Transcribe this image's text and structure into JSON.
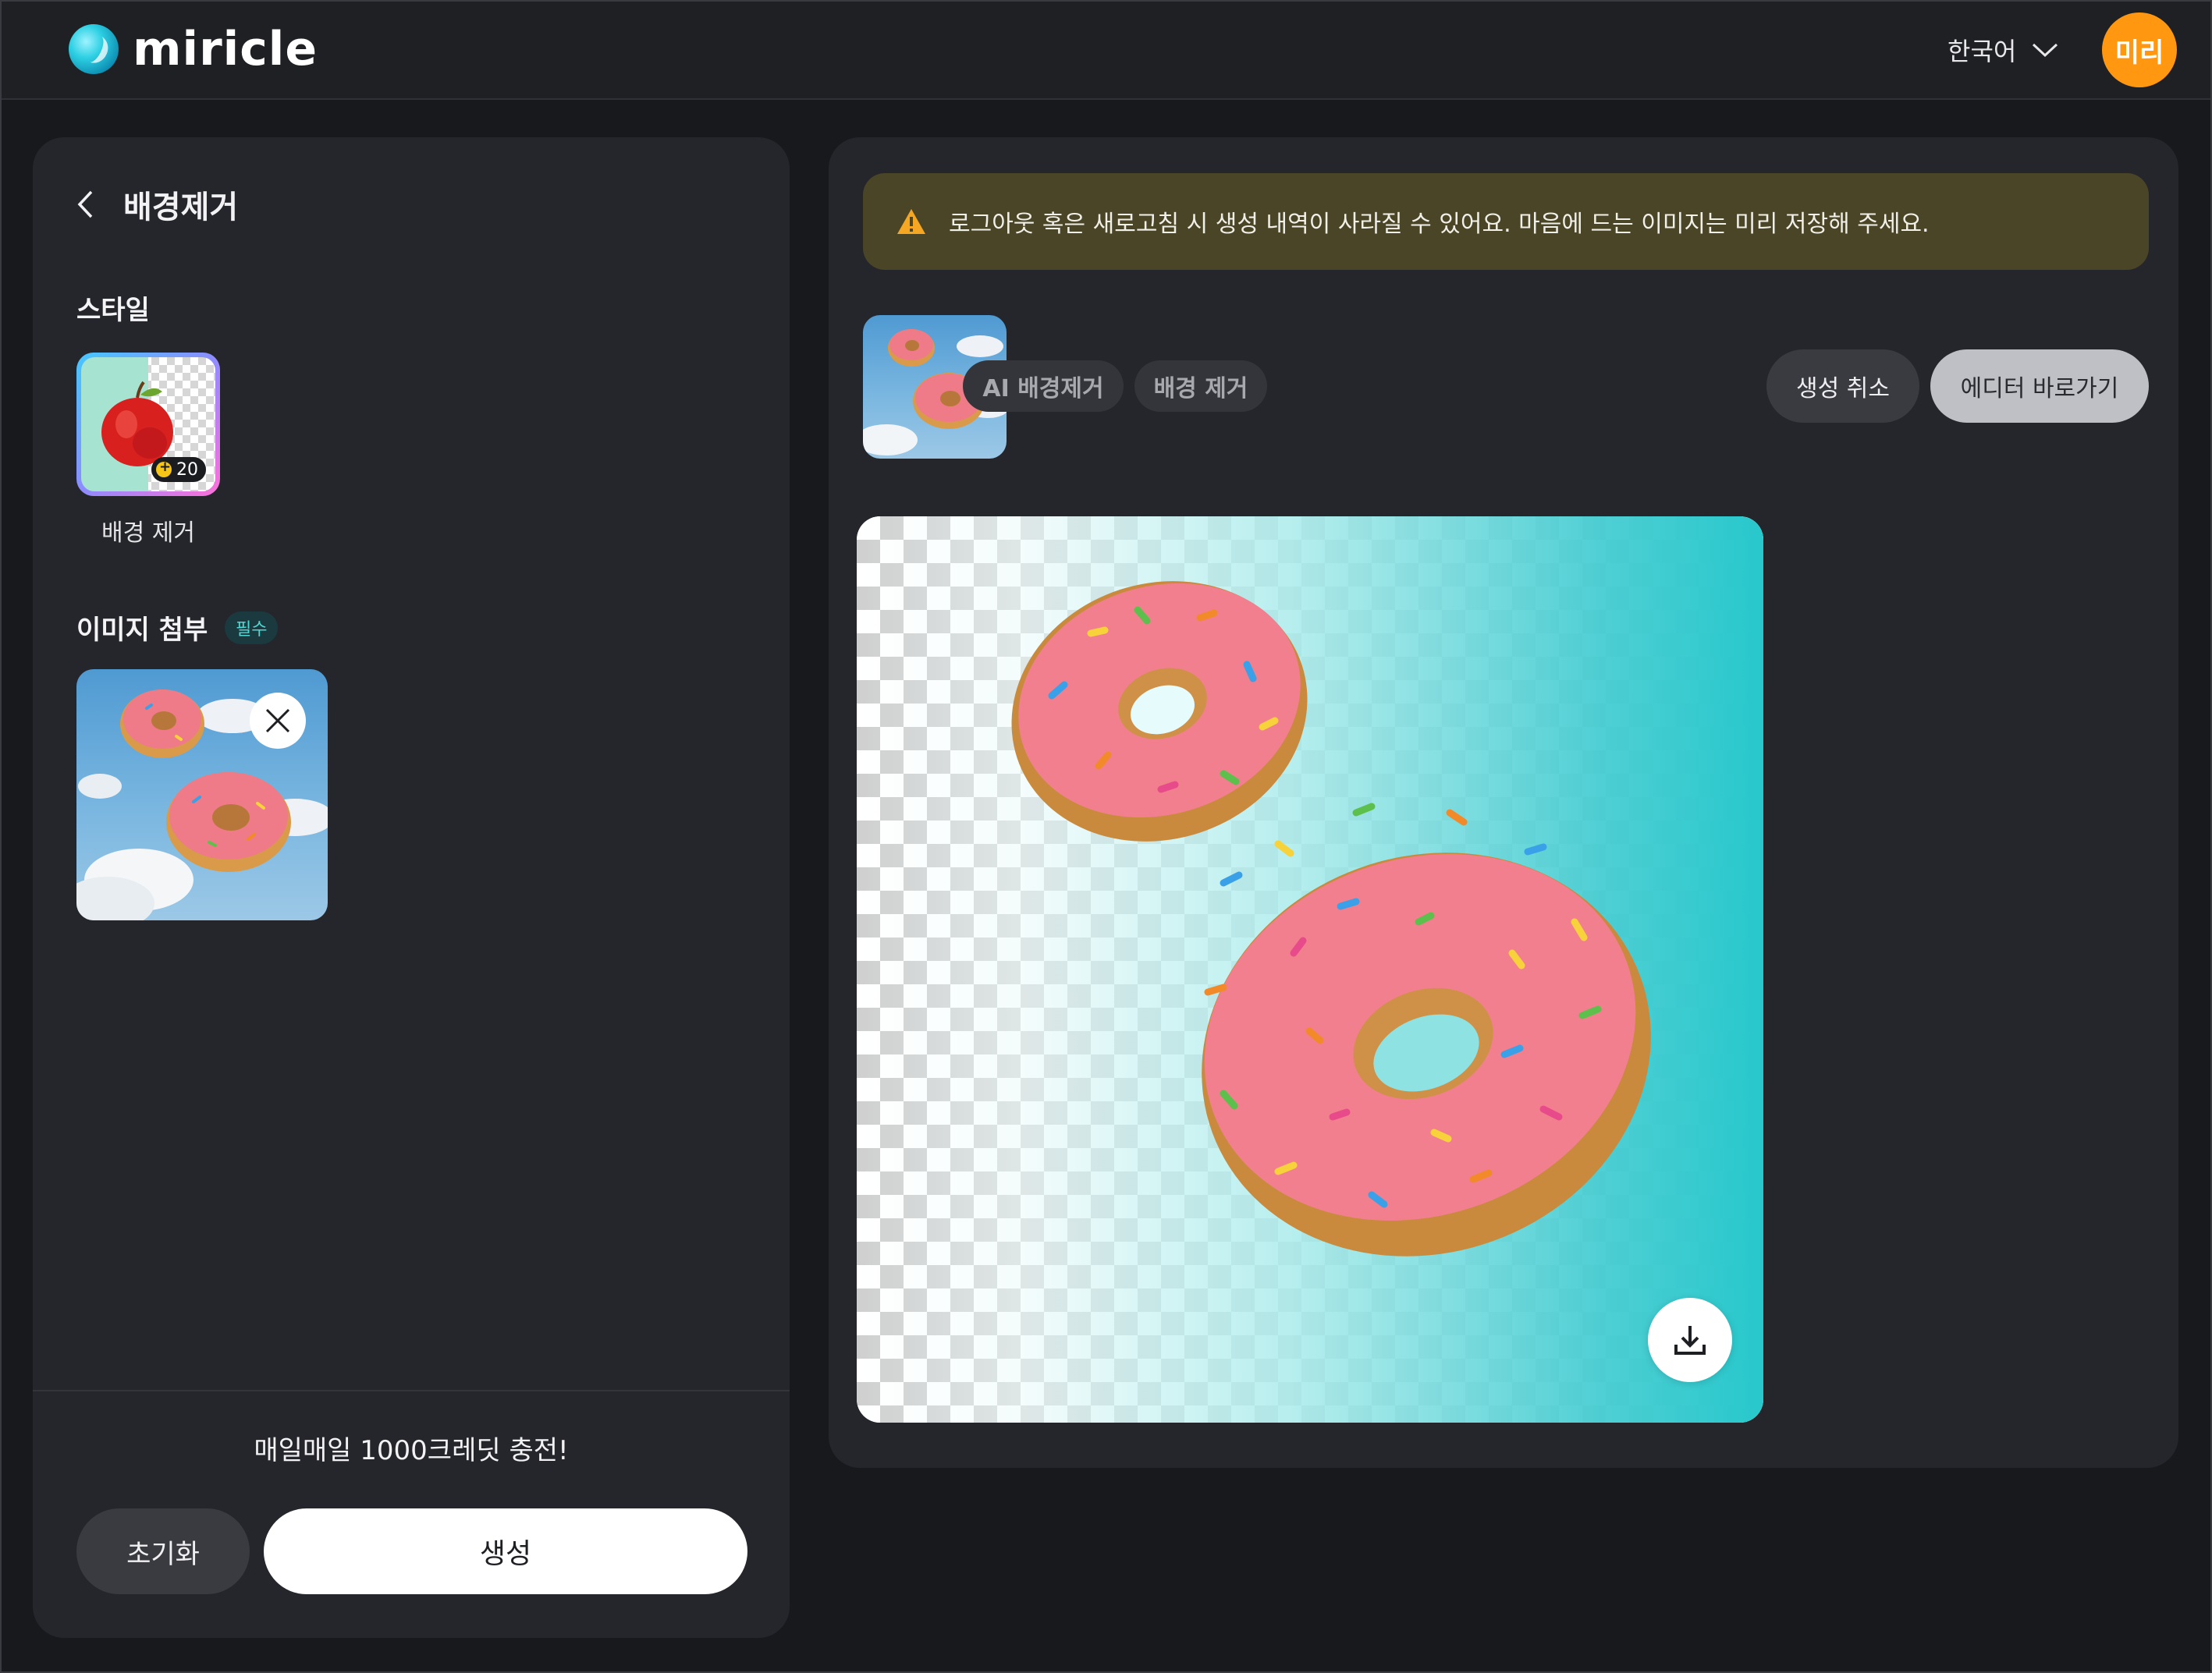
{
  "header": {
    "brand_name": "miricle",
    "language": "한국어",
    "avatar_text": "미리",
    "avatar_color": "#ff9710"
  },
  "left_panel": {
    "back_title": "배경제거",
    "style_section_label": "스타일",
    "style_card": {
      "caption": "배경 제거",
      "credit_cost": "20"
    },
    "attach_section_label": "이미지 첨부",
    "required_badge": "필수",
    "promo_text": "매일매일 1000크레딧 충전!",
    "reset_label": "초기화",
    "generate_label": "생성"
  },
  "right_panel": {
    "notice_text": "로그아웃 혹은 새로고침 시 생성 내역이 사라질 수 있어요. 마음에 드는 이미지는 미리 저장해 주세요.",
    "chips": [
      "AI 배경제거",
      "배경 제거"
    ],
    "cancel_label": "생성 취소",
    "editor_label": "에디터 바로가기"
  },
  "colors": {
    "accent_teal": "#27c8cc",
    "notice_bg": "#4a4527",
    "warning_icon": "#f5a623",
    "required_badge_text": "#4fd7d2"
  },
  "icons": [
    "back-chevron-icon",
    "chevron-down-icon",
    "credit-coin-icon",
    "close-icon",
    "warning-icon",
    "download-icon",
    "logo-icon"
  ]
}
